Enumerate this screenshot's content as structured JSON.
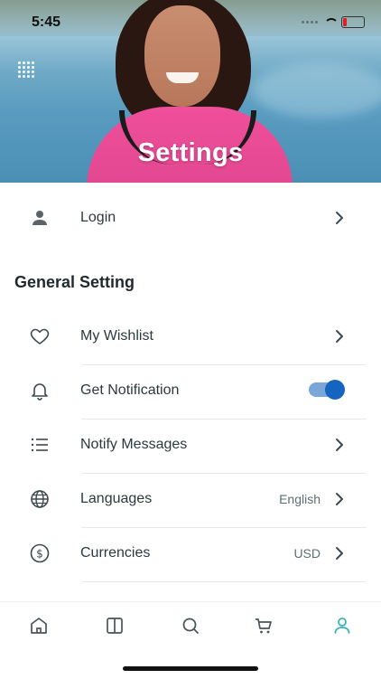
{
  "status_bar": {
    "time": "5:45"
  },
  "header": {
    "title": "Settings"
  },
  "login": {
    "label": "Login"
  },
  "general": {
    "title": "General Setting",
    "items": [
      {
        "label": "My Wishlist",
        "value": "",
        "icon": "heart-icon"
      },
      {
        "label": "Get Notification",
        "value": "",
        "icon": "bell-icon",
        "toggle_on": true
      },
      {
        "label": "Notify Messages",
        "value": "",
        "icon": "list-icon"
      },
      {
        "label": "Languages",
        "value": "English",
        "icon": "globe-icon"
      },
      {
        "label": "Currencies",
        "value": "USD",
        "icon": "dollar-icon"
      }
    ]
  },
  "tabbar": {
    "items": [
      "home-icon",
      "book-icon",
      "search-icon",
      "cart-icon",
      "user-icon"
    ],
    "active": "user-icon"
  },
  "colors": {
    "accent": "#3bb3b8",
    "toggle_on": "#1565c0",
    "text": "#2b3a3e"
  }
}
